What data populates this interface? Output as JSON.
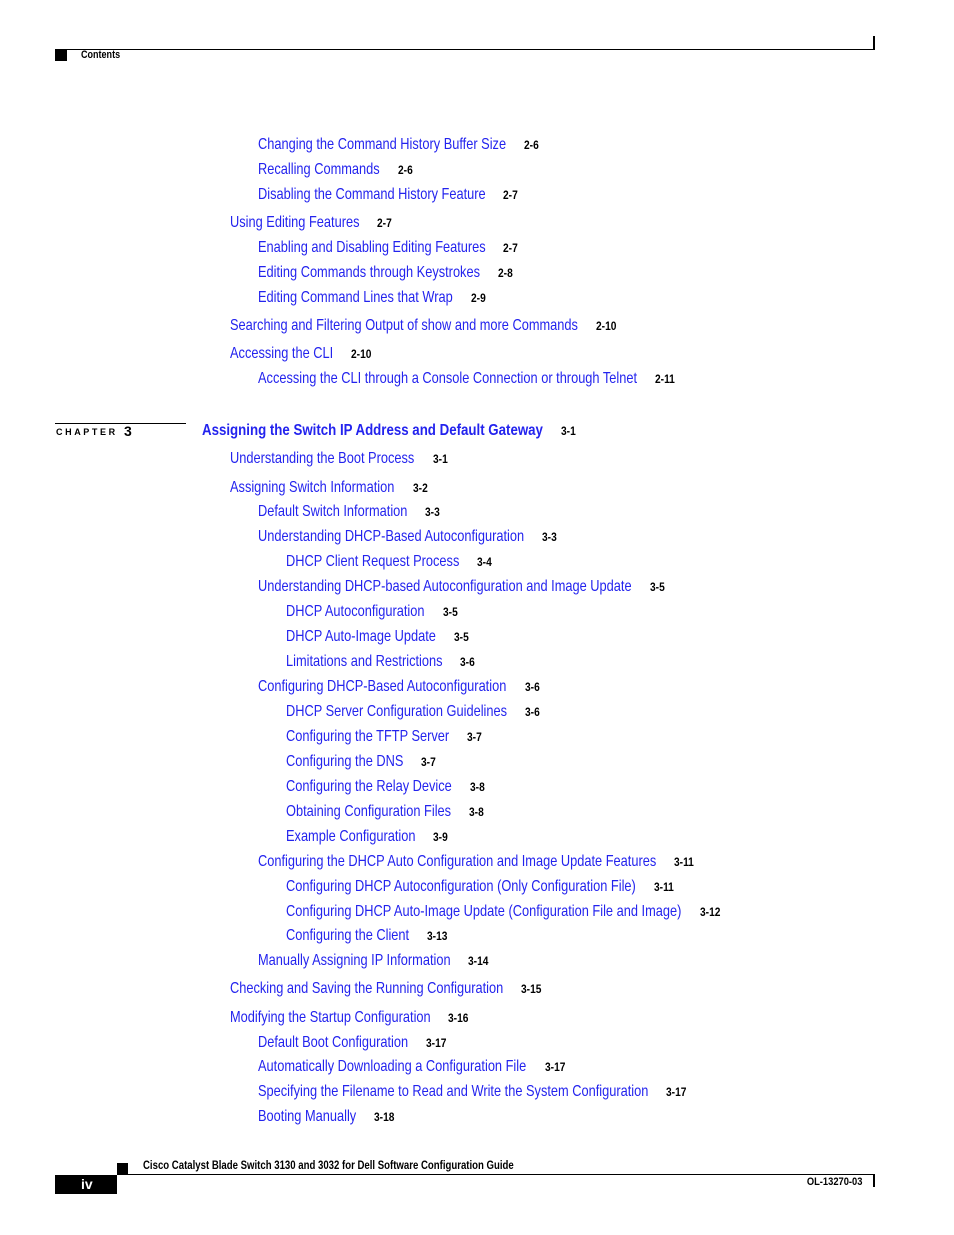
{
  "header": {
    "section_label": "Contents"
  },
  "chapter": {
    "label": "CHAPTER",
    "number": "3"
  },
  "toc": [
    {
      "level": 2,
      "title": "Changing the Command History Buffer Size",
      "page": "2-6"
    },
    {
      "level": 2,
      "title": "Recalling Commands",
      "page": "2-6"
    },
    {
      "level": 2,
      "title": "Disabling the Command History Feature",
      "page": "2-7"
    },
    {
      "level": 1,
      "title": "Using Editing Features",
      "page": "2-7"
    },
    {
      "level": 2,
      "title": "Enabling and Disabling Editing Features",
      "page": "2-7"
    },
    {
      "level": 2,
      "title": "Editing Commands through Keystrokes",
      "page": "2-8"
    },
    {
      "level": 2,
      "title": "Editing Command Lines that Wrap",
      "page": "2-9"
    },
    {
      "level": 1,
      "title": "Searching and Filtering Output of show and more Commands",
      "page": "2-10"
    },
    {
      "level": 1,
      "title": "Accessing the CLI",
      "page": "2-10"
    },
    {
      "level": 2,
      "title": "Accessing the CLI through a Console Connection or through Telnet",
      "page": "2-11"
    },
    {
      "level": 0,
      "title": "Assigning the Switch IP Address and Default Gateway",
      "page": "3-1"
    },
    {
      "level": 1,
      "title": "Understanding the Boot Process",
      "page": "3-1"
    },
    {
      "level": 1,
      "title": "Assigning Switch Information",
      "page": "3-2"
    },
    {
      "level": 2,
      "title": "Default Switch Information",
      "page": "3-3"
    },
    {
      "level": 2,
      "title": "Understanding DHCP-Based Autoconfiguration",
      "page": "3-3"
    },
    {
      "level": 3,
      "title": "DHCP Client Request Process",
      "page": "3-4"
    },
    {
      "level": 2,
      "title": "Understanding DHCP-based Autoconfiguration and Image Update",
      "page": "3-5"
    },
    {
      "level": 3,
      "title": "DHCP Autoconfiguration",
      "page": "3-5"
    },
    {
      "level": 3,
      "title": "DHCP Auto-Image Update",
      "page": "3-5"
    },
    {
      "level": 3,
      "title": "Limitations and Restrictions",
      "page": "3-6"
    },
    {
      "level": 2,
      "title": "Configuring DHCP-Based Autoconfiguration",
      "page": "3-6"
    },
    {
      "level": 3,
      "title": "DHCP Server Configuration Guidelines",
      "page": "3-6"
    },
    {
      "level": 3,
      "title": "Configuring the TFTP Server",
      "page": "3-7"
    },
    {
      "level": 3,
      "title": "Configuring the DNS",
      "page": "3-7"
    },
    {
      "level": 3,
      "title": "Configuring the Relay Device",
      "page": "3-8"
    },
    {
      "level": 3,
      "title": "Obtaining Configuration Files",
      "page": "3-8"
    },
    {
      "level": 3,
      "title": "Example Configuration",
      "page": "3-9"
    },
    {
      "level": 2,
      "title": "Configuring the DHCP Auto Configuration and Image Update Features",
      "page": "3-11"
    },
    {
      "level": 3,
      "title": "Configuring DHCP Autoconfiguration (Only Configuration File)",
      "page": "3-11"
    },
    {
      "level": 3,
      "title": "Configuring DHCP Auto-Image Update (Configuration File and Image)",
      "page": "3-12"
    },
    {
      "level": 3,
      "title": "Configuring the Client",
      "page": "3-13"
    },
    {
      "level": 2,
      "title": "Manually Assigning IP Information",
      "page": "3-14"
    },
    {
      "level": 1,
      "title": "Checking and Saving the Running Configuration",
      "page": "3-15"
    },
    {
      "level": 1,
      "title": "Modifying the Startup Configuration",
      "page": "3-16"
    },
    {
      "level": 2,
      "title": "Default Boot Configuration",
      "page": "3-17"
    },
    {
      "level": 2,
      "title": "Automatically Downloading a Configuration File",
      "page": "3-17"
    },
    {
      "level": 2,
      "title": "Specifying the Filename to Read and Write the System Configuration",
      "page": "3-17"
    },
    {
      "level": 2,
      "title": "Booting Manually",
      "page": "3-18"
    }
  ],
  "footer": {
    "guide_title": "Cisco Catalyst Blade Switch 3130 and 3032 for Dell Software Configuration Guide",
    "page_number": "iv",
    "doc_number": "OL-13270-03"
  }
}
